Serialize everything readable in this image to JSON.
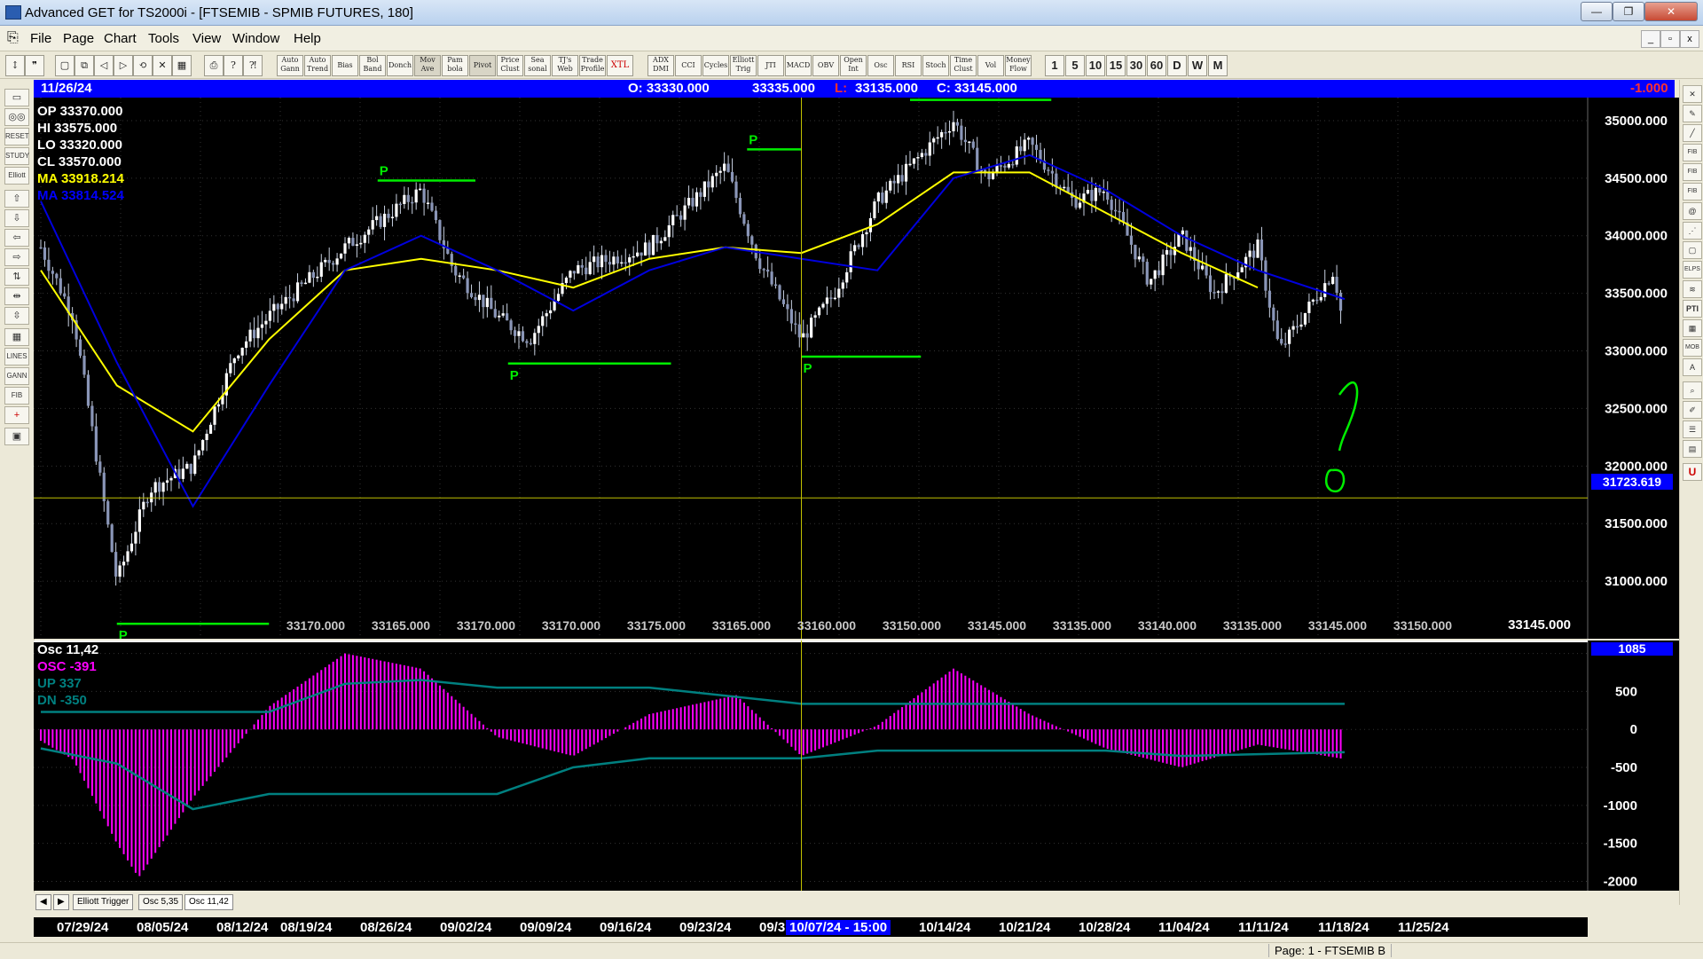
{
  "window": {
    "title": "Advanced GET for TS2000i - [FTSEMIB - SPMIB FUTURES, 180]",
    "controls": [
      "—",
      "❐",
      "✕"
    ]
  },
  "menu": [
    "File",
    "Page",
    "Chart",
    "Tools",
    "View",
    "Window",
    "Help"
  ],
  "toolbar": {
    "studies": [
      "Auto Gann",
      "Auto Trend",
      "Bias",
      "Bol Band",
      "Donch",
      "Mov Ave",
      "Pam bola",
      "Pivot",
      "Price Clust",
      "Sea sonal",
      "TJ's Web",
      "Trade Profile",
      "XTL",
      "ADX DMI",
      "CCI",
      "Cycles",
      "Elliott Trig",
      "JTI",
      "MACD",
      "OBV",
      "Open Int",
      "Osc",
      "RSI",
      "Stoch",
      "Time Clust",
      "Vol",
      "Money Flow"
    ],
    "periods": [
      "1",
      "5",
      "10",
      "15",
      "30",
      "60",
      "D",
      "W",
      "M"
    ]
  },
  "infobar": {
    "date": "11/26/24",
    "open": "O: 33330.000",
    "high": "33335.000",
    "low_label": "L:",
    "low": "33135.000",
    "close": "C: 33145.000",
    "change": "-1.000"
  },
  "price_panel": {
    "readouts": [
      {
        "label": "OP",
        "value": "33370.000",
        "color": "#ffffff"
      },
      {
        "label": "HI",
        "value": "33575.000",
        "color": "#ffffff"
      },
      {
        "label": "LO",
        "value": "33320.000",
        "color": "#ffffff"
      },
      {
        "label": "CL",
        "value": "33570.000",
        "color": "#ffffff"
      },
      {
        "label": "MA",
        "value": "33918.214",
        "color": "#ffff00"
      },
      {
        "label": "MA",
        "value": "33814.524",
        "color": "#0000ff"
      }
    ],
    "crosshair_price": "31723.619",
    "last_price": "33145.000",
    "cluster_labels": [
      "33170.000",
      "33165.000",
      "33170.000",
      "33170.000",
      "33175.000",
      "33165.000",
      "33160.000",
      "33150.000",
      "33145.000",
      "33135.000",
      "33140.000",
      "33135.000",
      "33145.000",
      "33150.000"
    ]
  },
  "osc_panel": {
    "title": "Osc 11,42",
    "osc": "OSC -391",
    "up": "UP   337",
    "dn": "DN   -350",
    "top_value": "1085"
  },
  "tabs": [
    "Elliott Trigger",
    "Osc 5,35",
    "Osc 11,42"
  ],
  "date_axis": [
    "07/29/24",
    "08/05/24",
    "08/12/24",
    "08/19/24",
    "08/26/24",
    "09/02/24",
    "09/09/24",
    "09/16/24",
    "09/23/24",
    "09/3",
    "10/07/24 - 15:00",
    "10/14/24",
    "10/21/24",
    "10/28/24",
    "11/04/24",
    "11/11/24",
    "11/18/24",
    "11/25/24"
  ],
  "annotations": {
    "pivot_label": "P",
    "question_mark": "?",
    "zero_mark": "0"
  },
  "status": {
    "page": "Page: 1 - FTSEMIB B"
  },
  "colors": {
    "background": "#000000",
    "candle": "#c8d0e0",
    "ma_fast": "#ffff00",
    "ma_slow": "#0000dd",
    "annotation": "#00ee00",
    "oscillator": "#ff00ff",
    "bands": "#008080",
    "crosshair": "#c0c000"
  },
  "chart_data": [
    {
      "type": "candlestick",
      "title": "FTSEMIB - SPMIB FUTURES, 180",
      "x_start": "07/29/24",
      "x_end": "11/26/24",
      "ylim": [
        30500,
        35200
      ],
      "yticks": [
        31000,
        31500,
        32000,
        32500,
        33000,
        33500,
        34000,
        34500,
        35000
      ],
      "close_path": [
        {
          "date": "07/29/24",
          "close": 33900
        },
        {
          "date": "08/01/24",
          "close": 33300
        },
        {
          "date": "08/05/24",
          "close": 31000
        },
        {
          "date": "08/08/24",
          "close": 31800
        },
        {
          "date": "08/12/24",
          "close": 32000
        },
        {
          "date": "08/16/24",
          "close": 33000
        },
        {
          "date": "08/19/24",
          "close": 33300
        },
        {
          "date": "08/26/24",
          "close": 33900
        },
        {
          "date": "09/02/24",
          "close": 34400
        },
        {
          "date": "09/05/24",
          "close": 33700
        },
        {
          "date": "09/09/24",
          "close": 33300
        },
        {
          "date": "09/12/24",
          "close": 33100
        },
        {
          "date": "09/16/24",
          "close": 33700
        },
        {
          "date": "09/23/24",
          "close": 33900
        },
        {
          "date": "09/30/24",
          "close": 34600
        },
        {
          "date": "10/03/24",
          "close": 33800
        },
        {
          "date": "10/07/24",
          "close": 33100
        },
        {
          "date": "10/10/24",
          "close": 33500
        },
        {
          "date": "10/14/24",
          "close": 34300
        },
        {
          "date": "10/21/24",
          "close": 35000
        },
        {
          "date": "10/24/24",
          "close": 34500
        },
        {
          "date": "10/28/24",
          "close": 34800
        },
        {
          "date": "11/01/24",
          "close": 34300
        },
        {
          "date": "11/04/24",
          "close": 34400
        },
        {
          "date": "11/08/24",
          "close": 33600
        },
        {
          "date": "11/11/24",
          "close": 34000
        },
        {
          "date": "11/14/24",
          "close": 33500
        },
        {
          "date": "11/18/24",
          "close": 33900
        },
        {
          "date": "11/20/24",
          "close": 33000
        },
        {
          "date": "11/25/24",
          "close": 33700
        },
        {
          "date": "11/26/24",
          "close": 33145
        }
      ],
      "series": [
        {
          "name": "MA",
          "color": "#ffff00",
          "values": [
            {
              "date": "07/29/24",
              "value": 33700
            },
            {
              "date": "08/05/24",
              "value": 32700
            },
            {
              "date": "08/12/24",
              "value": 32300
            },
            {
              "date": "08/19/24",
              "value": 33100
            },
            {
              "date": "08/26/24",
              "value": 33700
            },
            {
              "date": "09/02/24",
              "value": 33800
            },
            {
              "date": "09/09/24",
              "value": 33700
            },
            {
              "date": "09/16/24",
              "value": 33550
            },
            {
              "date": "09/23/24",
              "value": 33800
            },
            {
              "date": "09/30/24",
              "value": 33900
            },
            {
              "date": "10/07/24",
              "value": 33850
            },
            {
              "date": "10/14/24",
              "value": 34100
            },
            {
              "date": "10/21/24",
              "value": 34550
            },
            {
              "date": "10/28/24",
              "value": 34550
            },
            {
              "date": "11/04/24",
              "value": 34200
            },
            {
              "date": "11/11/24",
              "value": 33850
            },
            {
              "date": "11/18/24",
              "value": 33550
            }
          ]
        },
        {
          "name": "MA",
          "color": "#0000dd",
          "values": [
            {
              "date": "07/29/24",
              "value": 34300
            },
            {
              "date": "08/05/24",
              "value": 32900
            },
            {
              "date": "08/12/24",
              "value": 31650
            },
            {
              "date": "08/19/24",
              "value": 32700
            },
            {
              "date": "08/26/24",
              "value": 33700
            },
            {
              "date": "09/02/24",
              "value": 34000
            },
            {
              "date": "09/09/24",
              "value": 33700
            },
            {
              "date": "09/16/24",
              "value": 33350
            },
            {
              "date": "09/23/24",
              "value": 33700
            },
            {
              "date": "09/30/24",
              "value": 33900
            },
            {
              "date": "10/07/24",
              "value": 33800
            },
            {
              "date": "10/14/24",
              "value": 33700
            },
            {
              "date": "10/21/24",
              "value": 34500
            },
            {
              "date": "10/28/24",
              "value": 34700
            },
            {
              "date": "11/04/24",
              "value": 34400
            },
            {
              "date": "11/11/24",
              "value": 34000
            },
            {
              "date": "11/18/24",
              "value": 33700
            },
            {
              "date": "11/26/24",
              "value": 33450
            }
          ]
        }
      ],
      "pivot_lines": [
        {
          "label": "P",
          "from": "08/05/24",
          "to": "08/19/24",
          "price": 30630
        },
        {
          "label": "P",
          "from": "08/29/24",
          "to": "09/07/24",
          "price": 34480
        },
        {
          "label": "P",
          "from": "09/10/24",
          "to": "09/25/24",
          "price": 32890
        },
        {
          "label": "P",
          "from": "10/02/24",
          "to": "10/07/24",
          "price": 34750
        },
        {
          "label": "P",
          "from": "10/07/24",
          "to": "10/18/24",
          "price": 32950
        },
        {
          "label": "",
          "from": "10/17/24",
          "to": "10/30/24",
          "price": 35180
        }
      ],
      "crosshair": {
        "date": "10/07/24",
        "price": 31723.619
      }
    },
    {
      "type": "histogram",
      "title": "Osc 11,42",
      "ylim": [
        -2100,
        1100
      ],
      "yticks": [
        -2000,
        -1500,
        -1000,
        -500,
        0,
        500,
        1000
      ],
      "osc_path": [
        {
          "date": "07/29/24",
          "value": -150
        },
        {
          "date": "08/01/24",
          "value": -400
        },
        {
          "date": "08/05/24",
          "value": -1500
        },
        {
          "date": "08/07/24",
          "value": -1950
        },
        {
          "date": "08/12/24",
          "value": -900
        },
        {
          "date": "08/19/24",
          "value": 300
        },
        {
          "date": "08/26/24",
          "value": 1000
        },
        {
          "date": "09/02/24",
          "value": 800
        },
        {
          "date": "09/09/24",
          "value": -100
        },
        {
          "date": "09/16/24",
          "value": -350
        },
        {
          "date": "09/23/24",
          "value": 200
        },
        {
          "date": "10/01/24",
          "value": 450
        },
        {
          "date": "10/07/24",
          "value": -350
        },
        {
          "date": "10/14/24",
          "value": 50
        },
        {
          "date": "10/21/24",
          "value": 800
        },
        {
          "date": "10/28/24",
          "value": 200
        },
        {
          "date": "11/04/24",
          "value": -250
        },
        {
          "date": "11/11/24",
          "value": -500
        },
        {
          "date": "11/18/24",
          "value": -200
        },
        {
          "date": "11/26/24",
          "value": -391
        }
      ],
      "bands": [
        {
          "name": "UP",
          "values": [
            {
              "date": "07/29/24",
              "value": 230
            },
            {
              "date": "08/19/24",
              "value": 230
            },
            {
              "date": "08/26/24",
              "value": 600
            },
            {
              "date": "09/02/24",
              "value": 650
            },
            {
              "date": "09/09/24",
              "value": 550
            },
            {
              "date": "09/23/24",
              "value": 550
            },
            {
              "date": "10/07/24",
              "value": 337
            },
            {
              "date": "10/21/24",
              "value": 337
            },
            {
              "date": "10/28/24",
              "value": 337
            },
            {
              "date": "11/26/24",
              "value": 337
            }
          ]
        },
        {
          "name": "DN",
          "values": [
            {
              "date": "07/29/24",
              "value": -250
            },
            {
              "date": "08/05/24",
              "value": -450
            },
            {
              "date": "08/12/24",
              "value": -1050
            },
            {
              "date": "08/19/24",
              "value": -850
            },
            {
              "date": "09/09/24",
              "value": -850
            },
            {
              "date": "09/16/24",
              "value": -500
            },
            {
              "date": "09/23/24",
              "value": -380
            },
            {
              "date": "10/07/24",
              "value": -380
            },
            {
              "date": "10/14/24",
              "value": -280
            },
            {
              "date": "11/04/24",
              "value": -280
            },
            {
              "date": "11/11/24",
              "value": -350
            },
            {
              "date": "11/26/24",
              "value": -300
            }
          ]
        }
      ]
    }
  ]
}
